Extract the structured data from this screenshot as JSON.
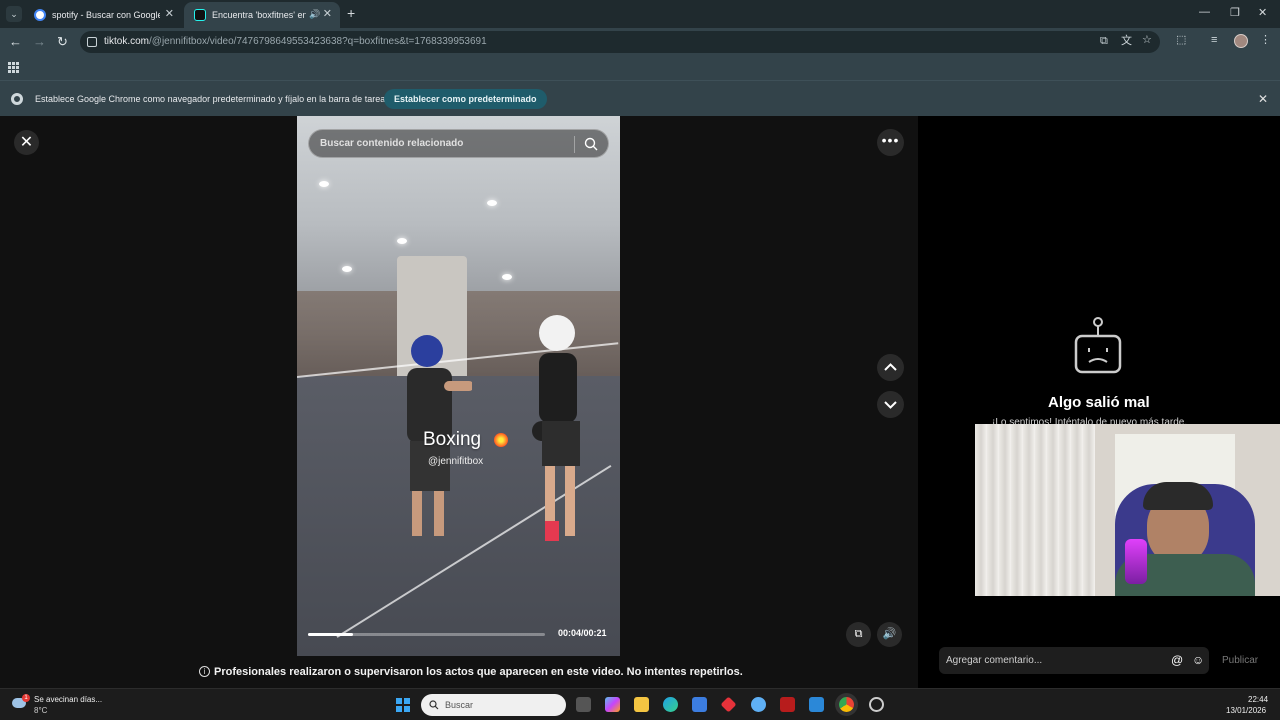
{
  "browser": {
    "tabs": [
      {
        "title": "spotify - Buscar con Google",
        "active": false
      },
      {
        "title": "Encuentra 'boxfitnes' en TikTok",
        "active": true
      }
    ],
    "url_host": "tiktok.com",
    "url_path": "/@jennifitbox/video/7476798649553423638?q=boxfitnes&t=1768339953691"
  },
  "infobar": {
    "message": "Establece Google Chrome como navegador predeterminado y fíjalo en la barra de tareas",
    "button": "Establecer como predeterminado"
  },
  "video": {
    "search_placeholder": "Buscar contenido relacionado",
    "overlay_title": "Boxing",
    "overlay_handle": "@jennifitbox",
    "time": "00:04/00:21",
    "progress": 0.19,
    "disclaimer": "Profesionales realizaron o supervisaron los actos que aparecen en este video. No intentes repetirlos."
  },
  "panel": {
    "error_title": "Algo salió mal",
    "error_sub": "¡Lo sentimos! Inténtalo de nuevo más tarde.",
    "comment_placeholder": "Agregar comentario...",
    "publish": "Publicar"
  },
  "taskbar": {
    "weather_title": "Se avecinan días...",
    "weather_temp": "8°C",
    "weather_badge": "1",
    "search": "Buscar",
    "time": "22:44",
    "date": "13/01/2026"
  }
}
